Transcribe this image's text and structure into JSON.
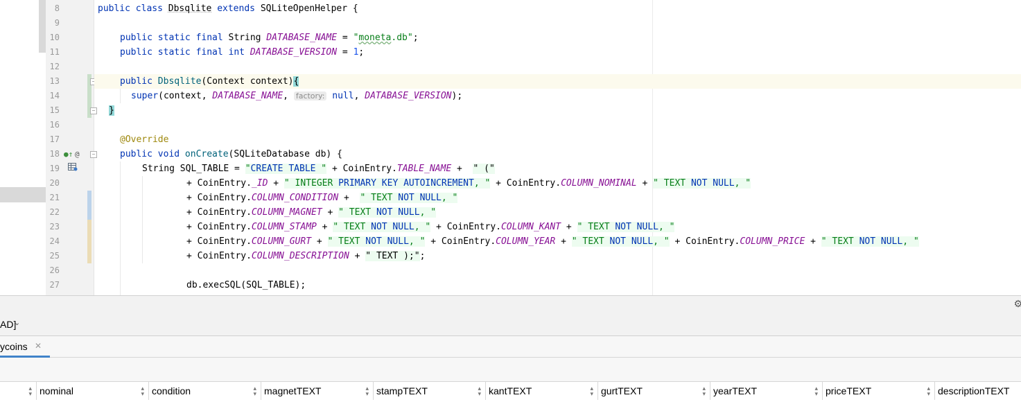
{
  "editor": {
    "lines": [
      {
        "num": "8"
      },
      {
        "num": "9"
      },
      {
        "num": "10"
      },
      {
        "num": "11"
      },
      {
        "num": "12"
      },
      {
        "num": "13"
      },
      {
        "num": "14"
      },
      {
        "num": "15"
      },
      {
        "num": "16"
      },
      {
        "num": "17"
      },
      {
        "num": "18"
      },
      {
        "num": "19"
      },
      {
        "num": "20"
      },
      {
        "num": "21"
      },
      {
        "num": "22"
      },
      {
        "num": "23"
      },
      {
        "num": "24"
      },
      {
        "num": "25"
      },
      {
        "num": "26"
      },
      {
        "num": "27"
      }
    ],
    "code": {
      "l8": {
        "kw1": "public class ",
        "cls": "Dbsqlite",
        "kw2": " extends ",
        "base": "SQLiteOpenHelper",
        "tail": " {"
      },
      "l10": {
        "kw": "public static final ",
        "ty": "String ",
        "cst": "DATABASE_NAME",
        "eq": " = ",
        "q1": "\"",
        "strval": "moneta",
        "strrest": ".db\"",
        "tail": ";"
      },
      "l11": {
        "kw": "public static final int ",
        "cst": "DATABASE_VERSION",
        "eq": " = ",
        "num": "1",
        "tail": ";"
      },
      "l13": {
        "kw": "public ",
        "cls": "Dbsqlite",
        "args": "(Context context)",
        "brace": "{"
      },
      "l14": {
        "fn": "super",
        "open": "(context, ",
        "cst1": "DATABASE_NAME",
        "comma": ", ",
        "hint": "factory:",
        "null": " null",
        "comma2": ", ",
        "cst2": "DATABASE_VERSION",
        "tail": ");"
      },
      "l15": {
        "brace": "}"
      },
      "l17": {
        "ann": "@Override"
      },
      "l18": {
        "kw": "public void ",
        "fn": "onCreate",
        "args": "(SQLiteDatabase db) {"
      },
      "l19": {
        "pre": "String SQL_TABLE = ",
        "s1a": "\"",
        "s1kw": "CREATE TABLE",
        "s1b": " \"",
        "mid": " + CoinEntry.",
        "cst": "TABLE_NAME",
        "plus": " +  ",
        "s2": "\" (\""
      },
      "l20": {
        "pre": "+ CoinEntry.",
        "cst1": "_ID",
        "plus1": " + ",
        "s1a": "\" INTEGER ",
        "s1kw": "PRIMARY KEY AUTOINCREMENT",
        "s1b": ", \"",
        "mid": " + CoinEntry.",
        "cst2": "COLUMN_NOMINAL",
        "plus2": " + ",
        "s2a": "\" TEXT ",
        "s2kw": "NOT NULL",
        "s2b": ", \""
      },
      "l21": {
        "pre": "+ CoinEntry.",
        "cst": "COLUMN_CONDITION",
        "plus": " +  ",
        "sa": "\" TEXT ",
        "skw": "NOT NULL",
        "sb": ", \""
      },
      "l22": {
        "pre": "+ CoinEntry.",
        "cst": "COLUMN_MAGNET",
        "plus": " + ",
        "sa": "\" TEXT ",
        "skw": "NOT NULL",
        "sb": ", \""
      },
      "l23": {
        "pre": "+ CoinEntry.",
        "cst1": "COLUMN_STAMP",
        "plus1": " + ",
        "s1a": "\" TEXT ",
        "s1kw": "NOT NULL",
        "s1b": ", \"",
        "mid": " + CoinEntry.",
        "cst2": "COLUMN_KANT",
        "plus2": " + ",
        "s2a": "\" TEXT ",
        "s2kw": "NOT NULL",
        "s2b": ", \""
      },
      "l24": {
        "pre": "+ CoinEntry.",
        "cst1": "COLUMN_GURT",
        "plus1": " + ",
        "s1a": "\" TEXT ",
        "s1kw": "NOT NULL",
        "s1b": ", \"",
        "mid1": " + CoinEntry.",
        "cst2": "COLUMN_YEAR",
        "plus2": " + ",
        "s2a": "\" TEXT ",
        "s2kw": "NOT NULL",
        "s2b": ", \"",
        "mid2": " + CoinEntry.",
        "cst3": "COLUMN_PRICE",
        "plus3": " + ",
        "s3a": "\" TEXT ",
        "s3kw": "NOT NULL",
        "s3b": ", \""
      },
      "l25": {
        "pre": "+ CoinEntry.",
        "cst": "COLUMN_DESCRIPTION",
        "plus": " + ",
        "s": "\" TEXT );\"",
        "tail": ";"
      },
      "l27": {
        "text": "db.execSQL(SQL_TABLE);"
      }
    }
  },
  "db_panel": {
    "connection_label": "AD]",
    "tab_label": "ycoins",
    "columns": [
      {
        "label": ""
      },
      {
        "label": "nominal"
      },
      {
        "label": "condition"
      },
      {
        "label": "magnetTEXT"
      },
      {
        "label": "stampTEXT"
      },
      {
        "label": "kantTEXT"
      },
      {
        "label": "gurtTEXT"
      },
      {
        "label": "yearTEXT"
      },
      {
        "label": "priceTEXT"
      },
      {
        "label": "descriptionTEXT"
      }
    ]
  },
  "colors": {
    "keyword": "#0033b3",
    "constant": "#871094",
    "string": "#067d17",
    "number": "#1750eb",
    "annotation": "#9e880d",
    "current_line": "#fcfaed",
    "tab_underline": "#4083c9"
  },
  "icons": [
    "override-up-icon",
    "annotation-at-icon",
    "db-table-icon",
    "fold-icon",
    "gear-icon",
    "chevron-down-icon",
    "close-icon",
    "sort-icon"
  ]
}
